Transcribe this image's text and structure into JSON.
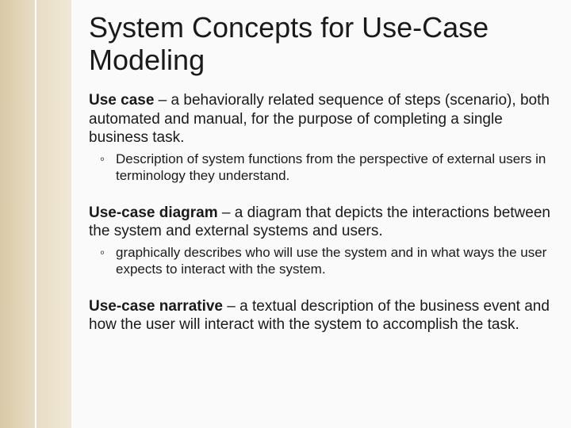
{
  "title": "System Concepts for Use-Case Modeling",
  "def1": {
    "term": "Use case",
    "text": " – a behaviorally related sequence of steps (scenario), both automated and manual, for the purpose of completing a single business task.",
    "sub": "Description of system functions from the perspective of external users in terminology they understand."
  },
  "def2": {
    "term": "Use-case diagram",
    "text": " – a diagram that depicts the interactions between the system and external systems and users.",
    "sub": "graphically describes who will use the system and in what ways the user expects to interact with the system."
  },
  "def3": {
    "term": "Use-case narrative",
    "text": " – a textual description of the business event and how the user will interact with the system to accomplish the task."
  }
}
